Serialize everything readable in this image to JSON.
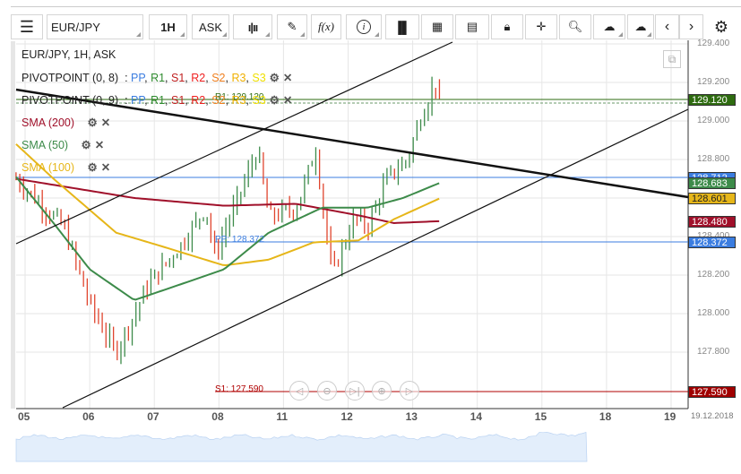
{
  "toolbar": {
    "symbol": "EUR/JPY",
    "interval": "1H",
    "price_type": "ASK",
    "fx_label": "f(x)"
  },
  "legend": {
    "title": "EUR/JPY, 1H, ASK",
    "pivot1": "PIVOTPOINT (0, 8)",
    "pivot2": "PIVOTPOINT (0, 9)",
    "pp": "PP",
    "r1": "R1",
    "s1": "S1",
    "r2": "R2",
    "s2": "S2",
    "r3": "R3",
    "s3": "S3",
    "sma200": "SMA (200)",
    "sma50": "SMA (50)",
    "sma100": "SMA (100)"
  },
  "levels": {
    "pp_label": "PP: 128.372",
    "s1_label": "S1: 127.590",
    "r1_label": "R1: 129.120"
  },
  "price_labels": {
    "r1": "129.120",
    "hidden": "128.712",
    "sma50": "128.683",
    "sma100": "128.601",
    "sma200": "128.480",
    "pp": "128.372",
    "s1": "127.590"
  },
  "date_label": "19.12.2018",
  "colors": {
    "up": "#3d8b4a",
    "down": "#e0452e",
    "sma200": "#a0102a",
    "sma50": "#3d8b4a",
    "sma100": "#e6b619",
    "pp": "#3b7de0",
    "s1": "#b00000",
    "r1": "#2e6b10"
  },
  "chart_data": {
    "type": "line",
    "y_ticks": [
      "129.400",
      "129.200",
      "129.000",
      "128.800",
      "128.600",
      "128.400",
      "128.200",
      "128.000",
      "127.800"
    ],
    "x_ticks": [
      "05",
      "06",
      "07",
      "08",
      "11",
      "12",
      "13",
      "14",
      "15",
      "18",
      "19"
    ],
    "ylim": [
      127.5,
      129.45
    ],
    "price_path": [
      [
        -0.14,
        128.7
      ],
      [
        0.3,
        128.55
      ],
      [
        0.6,
        128.45
      ],
      [
        1.0,
        128.05
      ],
      [
        1.4,
        127.8
      ],
      [
        1.7,
        128.0
      ],
      [
        1.9,
        128.15
      ],
      [
        2.4,
        128.35
      ],
      [
        2.8,
        128.55
      ],
      [
        2.93,
        128.3
      ],
      [
        3.3,
        128.6
      ],
      [
        3.6,
        128.85
      ],
      [
        3.77,
        128.5
      ],
      [
        4.2,
        128.55
      ],
      [
        4.5,
        128.85
      ],
      [
        4.75,
        128.2
      ],
      [
        5.1,
        128.5
      ],
      [
        5.3,
        128.45
      ],
      [
        5.6,
        128.7
      ],
      [
        5.92,
        128.8
      ],
      [
        6.1,
        129.0
      ],
      [
        6.35,
        129.2
      ],
      [
        6.43,
        129.1
      ]
    ],
    "sma200": [
      [
        -0.14,
        128.7
      ],
      [
        1.69,
        128.6
      ],
      [
        3.08,
        128.56
      ],
      [
        4.19,
        128.57
      ],
      [
        5.16,
        128.51
      ],
      [
        5.71,
        128.47
      ],
      [
        6.43,
        128.48
      ]
    ],
    "sma50": [
      [
        -0.14,
        128.71
      ],
      [
        0.44,
        128.47
      ],
      [
        1.0,
        128.23
      ],
      [
        1.69,
        128.07
      ],
      [
        2.39,
        128.15
      ],
      [
        3.08,
        128.23
      ],
      [
        3.77,
        128.42
      ],
      [
        4.6,
        128.55
      ],
      [
        5.3,
        128.55
      ],
      [
        5.85,
        128.6
      ],
      [
        6.43,
        128.68
      ]
    ],
    "sma100": [
      [
        -0.14,
        128.88
      ],
      [
        0.44,
        128.7
      ],
      [
        1.41,
        128.42
      ],
      [
        2.11,
        128.35
      ],
      [
        3.08,
        128.25
      ],
      [
        3.77,
        128.28
      ],
      [
        4.47,
        128.37
      ],
      [
        5.16,
        128.38
      ],
      [
        5.71,
        128.49
      ],
      [
        6.43,
        128.6
      ]
    ]
  }
}
